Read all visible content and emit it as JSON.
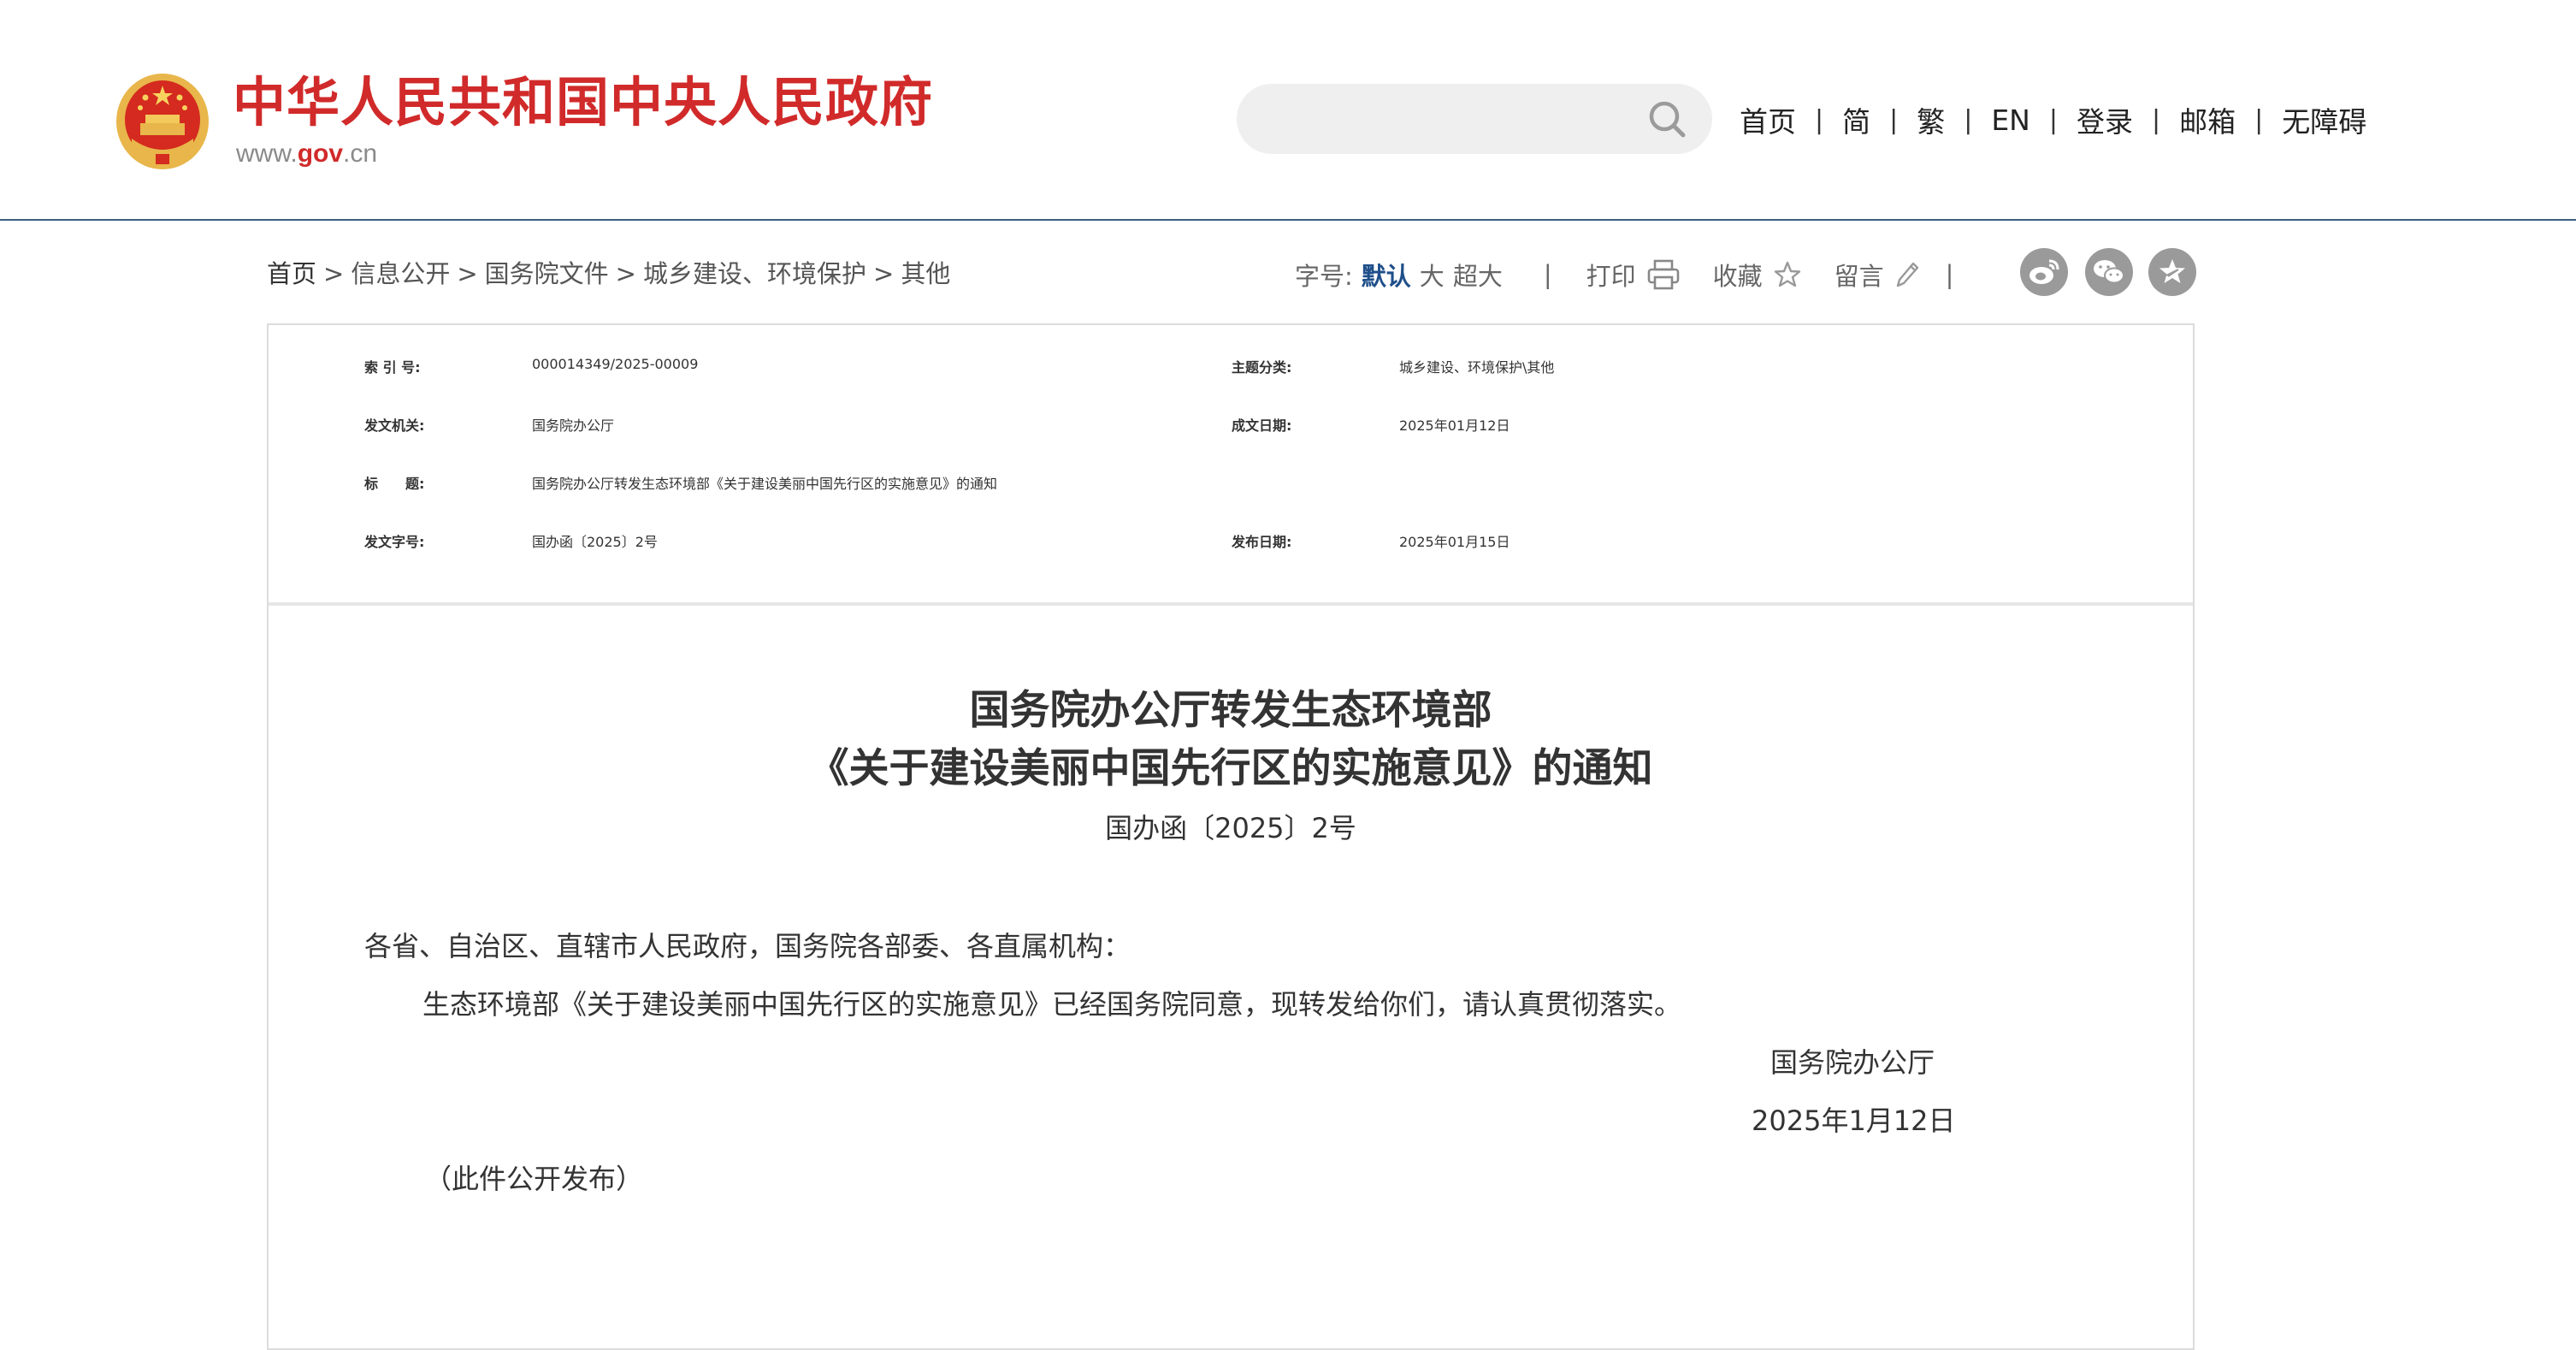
{
  "header": {
    "site_title": "中华人民共和国中央人民政府",
    "site_domain_prefix": "www.",
    "site_domain_main": "gov",
    "site_domain_suffix": ".cn",
    "emblem_icon": "national-emblem-icon",
    "search": {
      "placeholder": "",
      "icon": "search-icon"
    },
    "links": [
      "首页",
      "简",
      "繁",
      "EN",
      "登录",
      "邮箱",
      "无障碍"
    ],
    "link_separator": "|"
  },
  "breadcrumb": {
    "items": [
      "首页",
      "信息公开",
      "国务院文件",
      "城乡建设、环境保护",
      "其他"
    ],
    "separator": ">"
  },
  "tools": {
    "font_size_label": "字号:",
    "font_sizes": [
      "默认",
      "大",
      "超大"
    ],
    "font_size_selected": "默认",
    "divider": "|",
    "print_label": "打印",
    "print_icon": "printer-icon",
    "favorite_label": "收藏",
    "favorite_icon": "star-icon",
    "comment_label": "留言",
    "comment_icon": "pencil-icon",
    "share_icons": [
      "weibo-icon",
      "wechat-icon",
      "qzone-icon"
    ]
  },
  "meta": {
    "index_no_label": "索 引 号:",
    "index_no_value": "000014349/2025-00009",
    "category_label": "主题分类:",
    "category_value": "城乡建设、环境保护\\其他",
    "issuer_label": "发文机关:",
    "issuer_value": "国务院办公厅",
    "written_date_label": "成文日期:",
    "written_date_value": "2025年01月12日",
    "title_label": "标　　题:",
    "title_value": "国务院办公厅转发生态环境部《关于建设美丽中国先行区的实施意见》的通知",
    "doc_no_label": "发文字号:",
    "doc_no_value": "国办函〔2025〕2号",
    "publish_date_label": "发布日期:",
    "publish_date_value": "2025年01月15日"
  },
  "document": {
    "title_line1": "国务院办公厅转发生态环境部",
    "title_line2": "《关于建设美丽中国先行区的实施意见》的通知",
    "doc_number": "国办函〔2025〕2号",
    "salutation": "各省、自治区、直辖市人民政府，国务院各部委、各直属机构：",
    "paragraph": "生态环境部《关于建设美丽中国先行区的实施意见》已经国务院同意，现转发给你们，请认真贯彻落实。",
    "signature_org": "国务院办公厅",
    "signature_date": "2025年1月12日",
    "note": "（此件公开发布）"
  },
  "colors": {
    "title_red": "#d12a2a",
    "header_rule": "#3a5f82",
    "active_blue": "#1f4f8a",
    "social_gray": "#9a9a9a",
    "emblem_gold": "#e8b64a",
    "emblem_red": "#d42a1f"
  }
}
